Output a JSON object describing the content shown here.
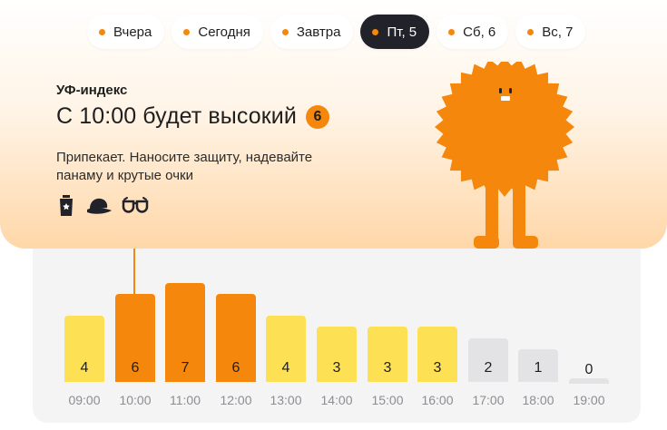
{
  "tabs": [
    {
      "label": "Вчера",
      "active": false
    },
    {
      "label": "Сегодня",
      "active": false
    },
    {
      "label": "Завтра",
      "active": false
    },
    {
      "label": "Пт, 5",
      "active": true
    },
    {
      "label": "Сб, 6",
      "active": false
    },
    {
      "label": "Вс, 7",
      "active": false
    }
  ],
  "uv": {
    "label": "УФ-индекс",
    "headline": "С 10:00 будет высокий",
    "max_index": "6",
    "description": "Припекает. Наносите защиту, надевайте панаму и крутые очки",
    "tips": [
      "sunscreen-icon",
      "panama-hat-icon",
      "sunglasses-icon"
    ]
  },
  "colors": {
    "accent_orange": "#f5870c",
    "moderate_yellow": "#fde054",
    "low_grey": "#e3e3e6",
    "active_tab": "#22222a"
  },
  "chart_data": {
    "type": "bar",
    "categories": [
      "09:00",
      "10:00",
      "11:00",
      "12:00",
      "13:00",
      "14:00",
      "15:00",
      "16:00",
      "17:00",
      "18:00",
      "19:00"
    ],
    "values": [
      4,
      6,
      7,
      6,
      4,
      3,
      3,
      3,
      2,
      1,
      0
    ],
    "ylim": [
      0,
      7
    ],
    "grid": false
  }
}
